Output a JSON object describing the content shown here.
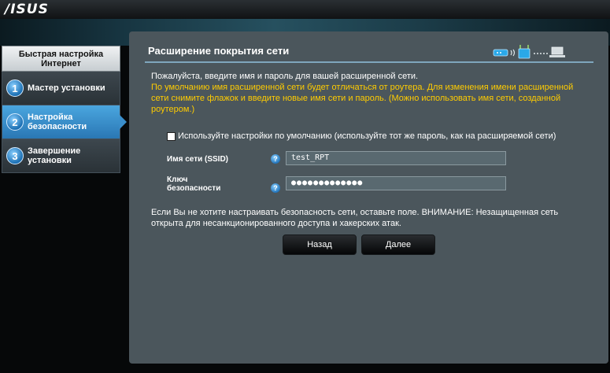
{
  "header": {
    "logo_text": "/ISUS"
  },
  "sidebar": {
    "heading": "Быстрая настройка Интернет",
    "steps": [
      {
        "number": "1",
        "label": "Мастер установки"
      },
      {
        "number": "2",
        "label": "Настройка безопасности"
      },
      {
        "number": "3",
        "label": "Завершение установки"
      }
    ]
  },
  "panel": {
    "title": "Расширение покрытия сети",
    "intro": "Пожалуйста, введите имя и пароль для вашей расширенной сети.",
    "hint": "По умолчанию имя расширенной сети будет отличаться от роутера. Для изменения имени расширенной сети снимите флажок и введите новые имя сети и пароль. (Можно использовать имя сети, созданной роутером.)",
    "checkbox_label": "Используйте настройки по умолчанию (используйте тот же пароль, как на расширяемой сети)",
    "ssid_label": "Имя сети (SSID)",
    "ssid_value": "test_RPT",
    "key_label": "Ключ безопасности",
    "key_value": "●●●●●●●●●●●●●",
    "help_glyph": "?",
    "note": "Если Вы не хотите настраивать безопасность сети, оставьте поле. ВНИМАНИЕ: Незащищенная сеть открыта для несанкционированного доступа и хакерских атак.",
    "back_button": "Назад",
    "next_button": "Далее"
  },
  "icons": [
    "router-icon",
    "wifi-signal-icon",
    "repeater-icon",
    "laptop-icon"
  ],
  "colors": {
    "accent": "#3a8ecb",
    "hint_text": "#ffcc00",
    "panel_bg": "#4b565c"
  }
}
